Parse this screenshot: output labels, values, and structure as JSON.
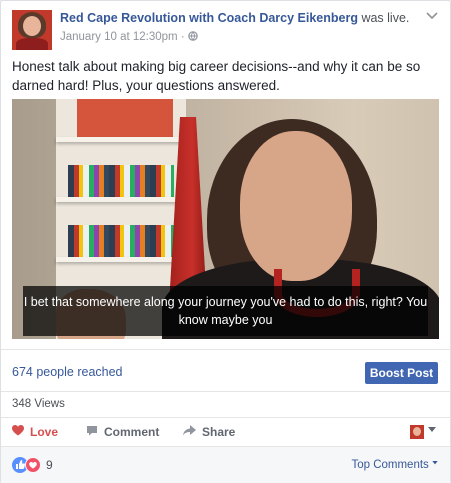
{
  "post": {
    "page_name": "Red Cape Revolution with Coach Darcy Eikenberg",
    "status_suffix": " was live.",
    "timestamp": "January 10 at 12:30pm",
    "separator": " · ",
    "privacy_icon": "globe-icon",
    "text": "Honest talk about making big career decisions--and why it can be so darned hard! Plus, your questions answered."
  },
  "video": {
    "caption": "I bet that somewhere along your journey you've had to do this, right? You know maybe you"
  },
  "insights": {
    "reached": "674 people reached",
    "boost_label": "Boost Post",
    "views": "348 Views"
  },
  "actions": {
    "love_label": "Love",
    "comment_label": "Comment",
    "share_label": "Share"
  },
  "footer": {
    "reaction_count": "9",
    "sort_label": "Top Comments"
  },
  "colors": {
    "link": "#365899",
    "boost": "#4267b2",
    "love": "#d64f4f"
  }
}
